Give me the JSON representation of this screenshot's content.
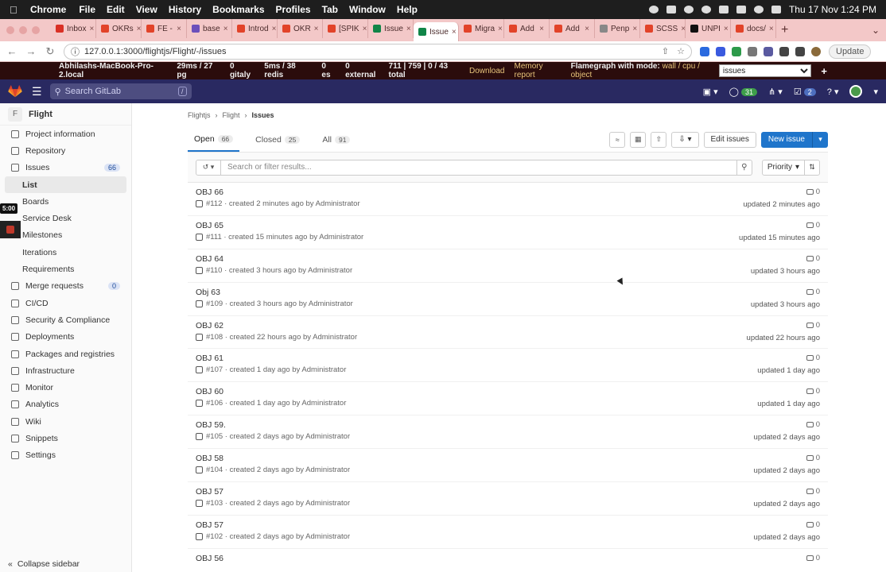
{
  "mac_menu": {
    "app": "Chrome",
    "items": [
      "File",
      "Edit",
      "View",
      "History",
      "Bookmarks",
      "Profiles",
      "Tab",
      "Window",
      "Help"
    ],
    "clock": "Thu 17 Nov  1:24 PM"
  },
  "browser": {
    "tabs": [
      {
        "label": "Inbox",
        "color": "#d93025"
      },
      {
        "label": "OKRs",
        "color": "#e24329"
      },
      {
        "label": "FE - ",
        "color": "#e24329"
      },
      {
        "label": "base",
        "color": "#6b4fbb"
      },
      {
        "label": "Introd",
        "color": "#e24329"
      },
      {
        "label": "OKR",
        "color": "#e24329"
      },
      {
        "label": "[SPIK",
        "color": "#e24329"
      },
      {
        "label": "Issue",
        "color": "#108548"
      },
      {
        "label": "Issue",
        "color": "#108548",
        "active": true
      },
      {
        "label": "Migra",
        "color": "#e24329"
      },
      {
        "label": "Add ",
        "color": "#e24329"
      },
      {
        "label": "Add ",
        "color": "#e24329"
      },
      {
        "label": "Penp",
        "color": "#888888"
      },
      {
        "label": "SCSS",
        "color": "#e24329"
      },
      {
        "label": "UNPI",
        "color": "#111111"
      },
      {
        "label": "docs/",
        "color": "#e24329"
      }
    ],
    "url": "127.0.0.1:3000/flightjs/Flight/-/issues",
    "update_label": "Update"
  },
  "perf_bar": {
    "host": "Abhilashs-MacBook-Pro-2.local",
    "pg": "29ms / 27 pg",
    "gitaly": "0 gitaly",
    "redis": "5ms / 38 redis",
    "es": "0 es",
    "external": "0 external",
    "totals": "711 | 759 | 0 / 43 total",
    "download": "Download",
    "memory": "Memory report",
    "flamegraph": "Flamegraph with mode:",
    "modes": "wall / cpu / object",
    "select_value": "issues"
  },
  "gitlab_header": {
    "search_placeholder": "Search GitLab",
    "slash_hint": "/",
    "issues_count": "31",
    "todos_count": "2"
  },
  "sidebar": {
    "project_initial": "F",
    "project_name": "Flight",
    "items": [
      {
        "label": "Project information",
        "icon": "info-icon"
      },
      {
        "label": "Repository",
        "icon": "doc-icon"
      },
      {
        "label": "Issues",
        "icon": "issues-icon",
        "badge": "66"
      },
      {
        "label": "List",
        "active": true
      },
      {
        "label": "Boards",
        "sub": true
      },
      {
        "label": "Service Desk",
        "sub": true
      },
      {
        "label": "Milestones",
        "sub": true
      },
      {
        "label": "Iterations",
        "sub": true
      },
      {
        "label": "Requirements",
        "sub": true
      },
      {
        "label": "Merge requests",
        "icon": "merge-icon",
        "badge": "0"
      },
      {
        "label": "CI/CD",
        "icon": "rocket-icon"
      },
      {
        "label": "Security & Compliance",
        "icon": "shield-icon"
      },
      {
        "label": "Deployments",
        "icon": "deploy-icon"
      },
      {
        "label": "Packages and registries",
        "icon": "package-icon"
      },
      {
        "label": "Infrastructure",
        "icon": "cloud-icon"
      },
      {
        "label": "Monitor",
        "icon": "monitor-icon"
      },
      {
        "label": "Analytics",
        "icon": "chart-icon"
      },
      {
        "label": "Wiki",
        "icon": "book-icon"
      },
      {
        "label": "Snippets",
        "icon": "scissors-icon"
      },
      {
        "label": "Settings",
        "icon": "gear-icon"
      }
    ],
    "collapse_label": "Collapse sidebar",
    "timer": "5:00"
  },
  "breadcrumb": [
    "Flightjs",
    "Flight",
    "Issues"
  ],
  "issue_tabs": [
    {
      "label": "Open",
      "count": "66",
      "active": true
    },
    {
      "label": "Closed",
      "count": "25"
    },
    {
      "label": "All",
      "count": "91"
    }
  ],
  "actions": {
    "edit_issues": "Edit issues",
    "new_issue": "New issue"
  },
  "filter": {
    "placeholder": "Search or filter results...",
    "sort_label": "Priority"
  },
  "issues": [
    {
      "title": "OBJ 66",
      "meta": "#112 · created 2 minutes ago by Administrator",
      "comments": "0",
      "updated": "updated 2 minutes ago"
    },
    {
      "title": "OBJ 65",
      "meta": "#111 · created 15 minutes ago by Administrator",
      "comments": "0",
      "updated": "updated 15 minutes ago"
    },
    {
      "title": "OBJ 64",
      "meta": "#110 · created 3 hours ago by Administrator",
      "comments": "0",
      "updated": "updated 3 hours ago"
    },
    {
      "title": "Obj 63",
      "meta": "#109 · created 3 hours ago by Administrator",
      "comments": "0",
      "updated": "updated 3 hours ago"
    },
    {
      "title": "OBJ 62",
      "meta": "#108 · created 22 hours ago by Administrator",
      "comments": "0",
      "updated": "updated 22 hours ago"
    },
    {
      "title": "OBJ 61",
      "meta": "#107 · created 1 day ago by Administrator",
      "comments": "0",
      "updated": "updated 1 day ago"
    },
    {
      "title": "OBJ 60",
      "meta": "#106 · created 1 day ago by Administrator",
      "comments": "0",
      "updated": "updated 1 day ago"
    },
    {
      "title": "OBJ 59.",
      "meta": "#105 · created 2 days ago by Administrator",
      "comments": "0",
      "updated": "updated 2 days ago"
    },
    {
      "title": "OBJ 58",
      "meta": "#104 · created 2 days ago by Administrator",
      "comments": "0",
      "updated": "updated 2 days ago"
    },
    {
      "title": "OBJ 57",
      "meta": "#103 · created 2 days ago by Administrator",
      "comments": "0",
      "updated": "updated 2 days ago"
    },
    {
      "title": "OBJ 57",
      "meta": "#102 · created 2 days ago by Administrator",
      "comments": "0",
      "updated": "updated 2 days ago"
    },
    {
      "title": "OBJ 56",
      "meta": "",
      "comments": "0",
      "updated": ""
    }
  ]
}
